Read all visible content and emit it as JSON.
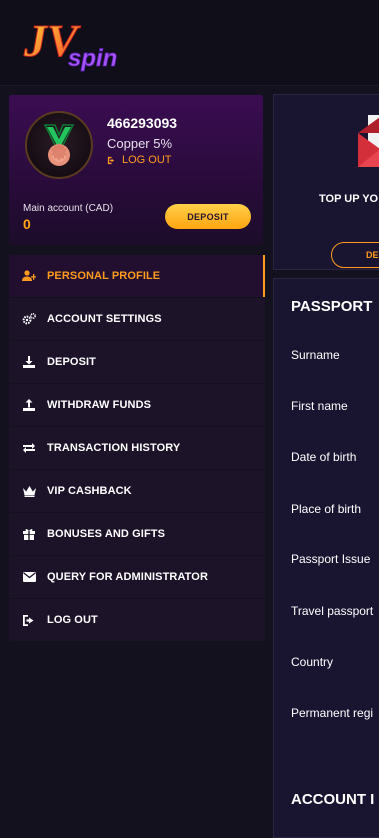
{
  "header": {
    "logo_icon": "jv-spin-logo"
  },
  "profile": {
    "user_id": "466293093",
    "level": "Copper 5%",
    "logout_label": "LOG OUT",
    "account_label": "Main account (CAD)",
    "balance": "0",
    "deposit_label": "DEPOSIT",
    "badge_icon": "medal-icon"
  },
  "menu": {
    "items": [
      {
        "label": "PERSONAL PROFILE",
        "icon": "user-plus-icon",
        "active": true
      },
      {
        "label": "ACCOUNT SETTINGS",
        "icon": "gears-icon"
      },
      {
        "label": "DEPOSIT",
        "icon": "download-icon"
      },
      {
        "label": "WITHDRAW FUNDS",
        "icon": "upload-icon"
      },
      {
        "label": "TRANSACTION HISTORY",
        "icon": "arrows-exchange-icon"
      },
      {
        "label": "VIP CASHBACK",
        "icon": "crown-icon"
      },
      {
        "label": "BONUSES AND GIFTS",
        "icon": "gift-icon"
      },
      {
        "label": "QUERY FOR ADMINISTRATOR",
        "icon": "envelope-icon"
      },
      {
        "label": "LOG OUT",
        "icon": "sign-out-icon"
      }
    ]
  },
  "topup": {
    "title": "TOP UP YO",
    "button_label": "DE",
    "icon": "envelope-icon"
  },
  "passport": {
    "title": "PASSPORT",
    "fields": [
      "Surname",
      "First name",
      "Date of birth",
      "Place of birth",
      "Passport Issue",
      "Travel passport",
      "Country",
      "Permanent regi"
    ]
  },
  "account_section": {
    "title": "ACCOUNT I"
  },
  "colors": {
    "accent": "#ff9b1e",
    "background": "#13111d",
    "panel": "#1c1329"
  }
}
